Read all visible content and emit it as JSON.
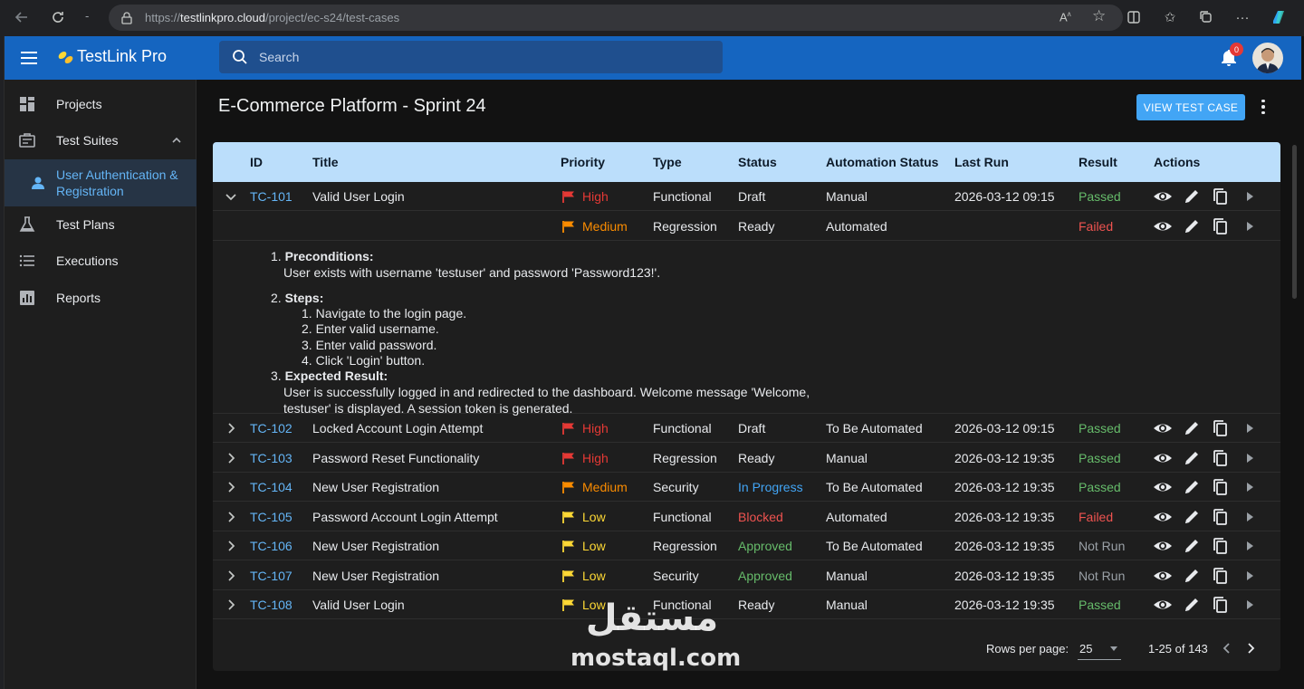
{
  "browser": {
    "url_prefix": "https://",
    "url_host": "testlinkpro.cloud",
    "url_path": "/project/ec-s24/test-cases"
  },
  "app": {
    "title": "TestLink Pro",
    "search_placeholder": "Search",
    "notification_count": "0",
    "brand_color": "#1565c0"
  },
  "sidebar": {
    "items": [
      {
        "label": "Projects",
        "icon": "grid-icon"
      },
      {
        "label": "Test Suites",
        "icon": "suites-icon",
        "expanded": true
      },
      {
        "label": "User Authentication & Registration",
        "icon": "person-icon",
        "active": true
      },
      {
        "label": "Test Plans",
        "icon": "flask-icon"
      },
      {
        "label": "Executions",
        "icon": "list-icon"
      },
      {
        "label": "Reports",
        "icon": "chart-icon"
      }
    ]
  },
  "page": {
    "title": "E-Commerce Platform - Sprint 24",
    "view_button": "VIEW TEST CASE"
  },
  "table": {
    "columns": [
      "ID",
      "Title",
      "Priority",
      "Type",
      "Status",
      "Automation Status",
      "Last Run",
      "Result",
      "Actions"
    ],
    "rows": [
      {
        "id": "TC-101",
        "title": "Valid User Login",
        "priority": "High",
        "type": "Functional",
        "status": "Draft",
        "automation": "Manual",
        "last_run": "2026-03-12 09:15",
        "result": "Passed",
        "expanded": true
      },
      {
        "id": "",
        "title": "",
        "priority": "Medium",
        "type": "Regression",
        "status": "Ready",
        "automation": "Automated",
        "last_run": "",
        "result": "Failed"
      },
      {
        "id": "TC-102",
        "title": "Locked Account Login Attempt",
        "priority": "High",
        "type": "Functional",
        "status": "Draft",
        "automation": "To Be Automated",
        "last_run": "2026-03-12 09:15",
        "result": "Passed"
      },
      {
        "id": "TC-103",
        "title": "Password Reset Functionality",
        "priority": "High",
        "type": "Regression",
        "status": "Ready",
        "automation": "Manual",
        "last_run": "2026-03-12 19:35",
        "result": "Passed"
      },
      {
        "id": "TC-104",
        "title": "New User Registration",
        "priority": "Medium",
        "type": "Security",
        "status": "In Progress",
        "automation": "To Be Automated",
        "last_run": "2026-03-12 19:35",
        "result": "Passed"
      },
      {
        "id": "TC-105",
        "title": "Password Account Login Attempt",
        "priority": "Low",
        "type": "Functional",
        "status": "Blocked",
        "automation": "Automated",
        "last_run": "2026-03-12 19:35",
        "result": "Failed"
      },
      {
        "id": "TC-106",
        "title": "New User Registration",
        "priority": "Low",
        "type": "Regression",
        "status": "Approved",
        "automation": "To Be Automated",
        "last_run": "2026-03-12 19:35",
        "result": "Not Run"
      },
      {
        "id": "TC-107",
        "title": "New User Registration",
        "priority": "Low",
        "type": "Security",
        "status": "Approved",
        "automation": "Manual",
        "last_run": "2026-03-12 19:35",
        "result": "Not Run"
      },
      {
        "id": "TC-108",
        "title": "Valid User Login",
        "priority": "Low",
        "type": "Functional",
        "status": "Ready",
        "automation": "Manual",
        "last_run": "2026-03-12 19:35",
        "result": "Passed"
      }
    ],
    "details": {
      "preconditions_label": "Preconditions:",
      "preconditions_text": "User exists with username 'testuser' and password 'Password123!'.",
      "steps_label": "Steps:",
      "steps": [
        "Navigate to the login page.",
        "Enter valid username.",
        "Enter valid password.",
        "Click 'Login' button."
      ],
      "expected_label": "Expected Result:",
      "expected_line1": "User is successfully logged in and redirected to the dashboard. Welcome message 'Welcome,",
      "expected_line2": "testuser' is displayed. A session token is generated."
    },
    "footer": {
      "rows_per_page_label": "Rows per page:",
      "rows_per_page": "25",
      "range": "1-25 of 143"
    }
  },
  "colors": {
    "priority_high": "#e53935",
    "priority_medium": "#fb8c00",
    "priority_low": "#fdd835",
    "result_passed": "#66bb6a",
    "result_failed": "#ef5350",
    "status_progress": "#42a5f5",
    "status_blocked": "#ef5350",
    "status_approved": "#66bb6a"
  },
  "watermark": {
    "arabic": "مستقل",
    "latin": "mostaql.com"
  }
}
